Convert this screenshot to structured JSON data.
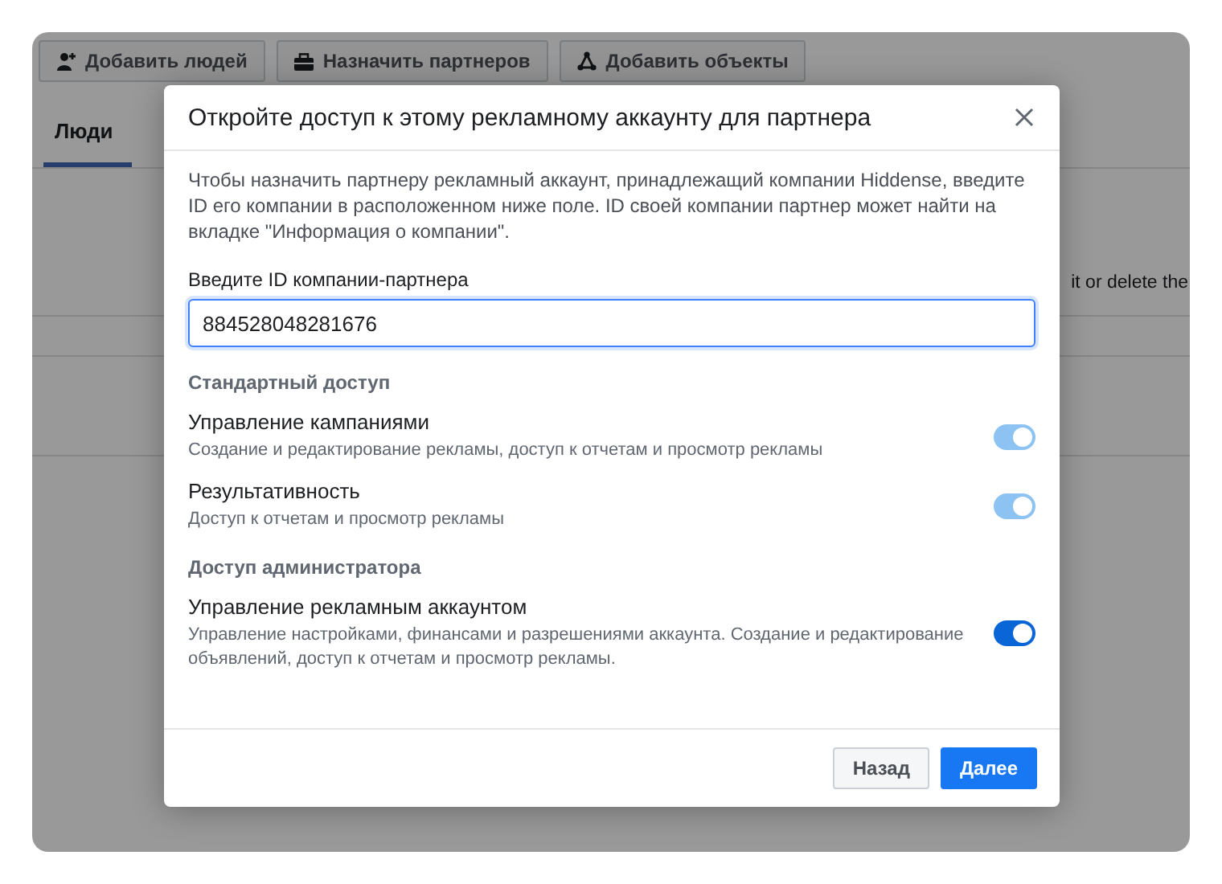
{
  "background": {
    "toolbar": [
      {
        "label": "Добавить людей"
      },
      {
        "label": "Назначить партнеров"
      },
      {
        "label": "Добавить объекты"
      }
    ],
    "tabs": [
      {
        "label": "Люди",
        "selected": true
      }
    ],
    "partial_text": "it or delete the"
  },
  "dialog": {
    "title": "Откройте доступ к этому рекламному аккаунту для партнера",
    "intro": "Чтобы назначить партнеру рекламный аккаунт, принадлежащий компании Hiddense, введите ID его компании в расположенном ниже поле. ID своей компании партнер может найти на вкладке \"Информация о компании\".",
    "field": {
      "label": "Введите ID компании-партнера",
      "value": "884528048281676"
    },
    "sections": [
      {
        "heading": "Стандартный доступ",
        "permissions": [
          {
            "name": "Управление кампаниями",
            "description": "Создание и редактирование рекламы, доступ к отчетам и просмотр рекламы",
            "on": true,
            "disabled": true
          },
          {
            "name": "Результативность",
            "description": "Доступ к отчетам и просмотр рекламы",
            "on": true,
            "disabled": true
          }
        ]
      },
      {
        "heading": "Доступ администратора",
        "permissions": [
          {
            "name": "Управление рекламным аккаунтом",
            "description": "Управление настройками, финансами и разрешениями аккаунта. Создание и редактирование объявлений, доступ к отчетам и просмотр рекламы.",
            "on": true,
            "disabled": false
          }
        ]
      }
    ],
    "buttons": [
      {
        "label": "Назад",
        "kind": "secondary"
      },
      {
        "label": "Далее",
        "kind": "primary"
      }
    ]
  }
}
